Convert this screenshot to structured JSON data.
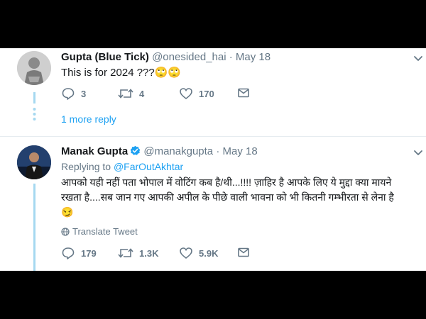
{
  "tweet1": {
    "name": "Gupta (Blue Tick)",
    "handle": "@onesided_hai",
    "date": "· May 18",
    "text": "This is for 2024 ???🙄🙄",
    "replies": "3",
    "retweets": "4",
    "likes": "170",
    "more_replies": "1 more reply"
  },
  "tweet2": {
    "name": "Manak Gupta",
    "handle": "@manakgupta",
    "date": "· May 18",
    "replying_label": "Replying to",
    "replying_to": "@FarOutAkhtar",
    "text_line1": "आपको यही नहीं पता भोपाल में वोटिंग कब है/थी...!!!! ज़ाहिर है आपके लिए ये मुद्दा क्या मायने",
    "text_line2": "रखता है....सब जान गए आपकी अपील के पीछे वाली भावना को भी कितनी गम्भीरता से लेना है",
    "text_line3": "😏",
    "translate": "Translate Tweet",
    "replies": "179",
    "retweets": "1.3K",
    "likes": "5.9K"
  },
  "colors": {
    "accent": "#1da1f2",
    "thread": "#a5d8f0",
    "muted": "#657786"
  }
}
